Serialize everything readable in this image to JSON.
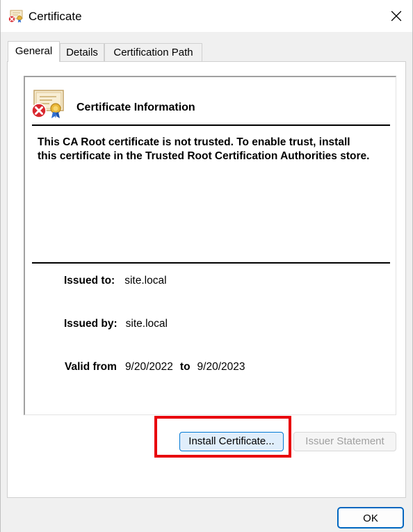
{
  "window": {
    "title": "Certificate"
  },
  "tabs": [
    {
      "label": "General",
      "active": true
    },
    {
      "label": "Details",
      "active": false
    },
    {
      "label": "Certification Path",
      "active": false
    }
  ],
  "info": {
    "heading": "Certificate Information",
    "warning": "This CA Root certificate is not trusted. To enable trust, install this certificate in the Trusted Root Certification Authorities store.",
    "issued_to_label": "Issued to:",
    "issued_to": "site.local",
    "issued_by_label": "Issued by:",
    "issued_by": "site.local",
    "valid_from_label": "Valid from",
    "valid_from": "9/20/2022",
    "valid_to_label": "to",
    "valid_to": "9/20/2023"
  },
  "buttons": {
    "install": "Install Certificate...",
    "issuer": "Issuer Statement",
    "ok": "OK"
  },
  "icons": {
    "window": "certificate-error-icon",
    "close": "close-icon",
    "cert": "certificate-error-icon"
  },
  "colors": {
    "highlight": "#e8000a",
    "accent": "#0078d4",
    "error_red": "#d9272e"
  }
}
